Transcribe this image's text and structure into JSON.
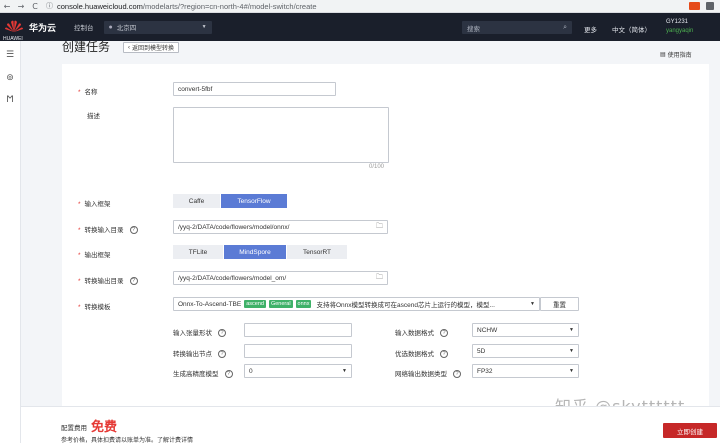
{
  "browser": {
    "back": "←",
    "forward": "→",
    "reload": "C",
    "lock": "ⓘ",
    "url_host": "console.huaweicloud.com",
    "url_path": "/modelarts/?region=cn-north-4#/model-switch/create"
  },
  "header": {
    "logo_text": "HUAWEI",
    "brand": "华为云",
    "console": "控制台",
    "region": "北京四",
    "search_placeholder": "搜索",
    "more": "更多",
    "lang": "中文（简体）",
    "account": "GY1231",
    "username": "yangyaqin"
  },
  "page": {
    "title": "创建任务",
    "back_label": "返回到模型转换",
    "guide_label": "使用指南"
  },
  "form": {
    "name_label": "名称",
    "name_value": "convert-5fbf",
    "desc_label": "描述",
    "desc_counter": "0/100",
    "input_framework_label": "输入框架",
    "input_frameworks": [
      "Caffe",
      "TensorFlow"
    ],
    "input_framework_selected": "TensorFlow",
    "input_dir_label": "转换输入目录",
    "input_dir_value": "/yyq-2/DATA/code/flowers/model/onnx/",
    "output_framework_label": "输出框架",
    "output_frameworks": [
      "TFLite",
      "MindSpore",
      "TensorRT"
    ],
    "output_framework_selected": "MindSpore",
    "output_dir_label": "转换输出目录",
    "output_dir_value": "/yyq-2/DATA/code/flowers/model_om/",
    "template_label": "转换模板",
    "template_value": "Onnx-To-Ascend-TBE",
    "template_tags": [
      "ascend",
      "General",
      "onnx"
    ],
    "template_desc": "支持将Onnx模型转换成可在ascend芯片上运行的模型，模型...",
    "reset_label": "重置",
    "input_shape_label": "输入张量形状",
    "input_shape_value": "",
    "input_format_label": "输入数据格式",
    "input_format_value": "NCHW",
    "output_nodes_label": "转换输出节点",
    "output_nodes_value": "",
    "opt_format_label": "优选数据格式",
    "opt_format_value": "5D",
    "precision_label": "生成高精度模型",
    "precision_value": "0",
    "net_output_label": "网络输出数据类型",
    "net_output_value": "FP32"
  },
  "footer": {
    "fee_label": "配置费用",
    "fee_value": "免费",
    "note": "参考价格，具体扣费请以账单为准。了解计费详情",
    "create_label": "立即创建"
  },
  "watermark": "知乎 @skytttttt",
  "colors": {
    "header_bg": "#1a1f2b",
    "accent_blue": "#5b7bd5",
    "danger_red": "#c62828",
    "tag_green": "#3fb168"
  }
}
